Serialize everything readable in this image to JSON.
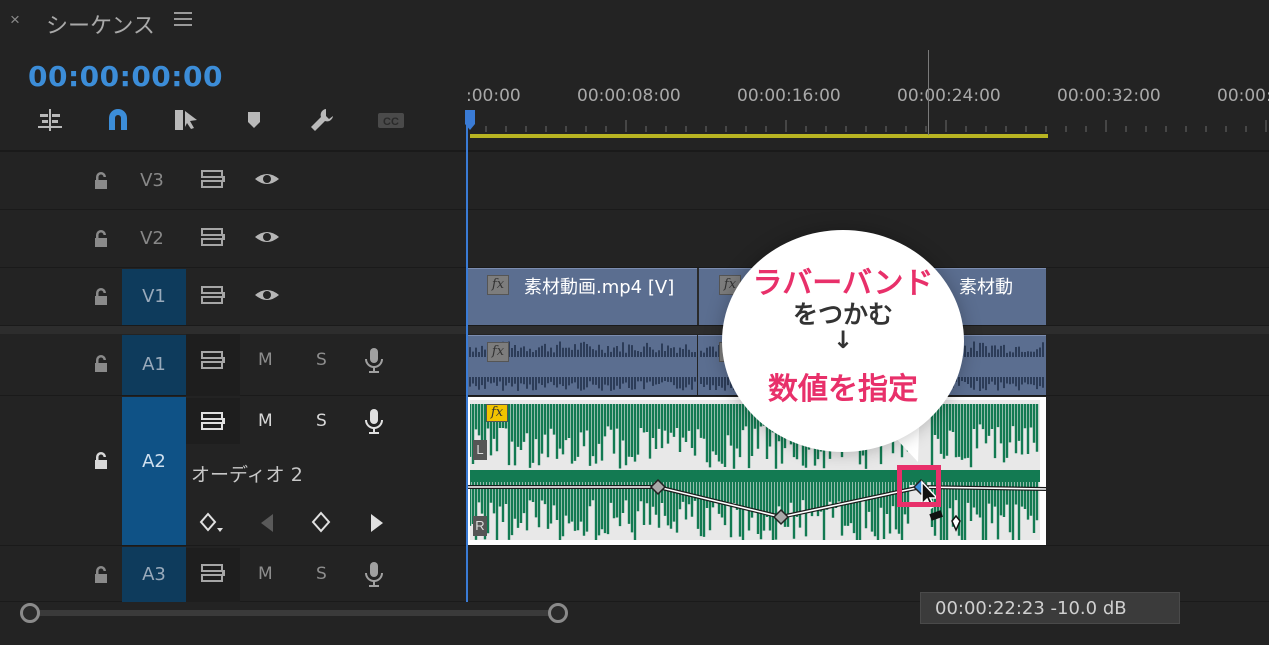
{
  "panel": {
    "close": "×",
    "title": "シーケンス"
  },
  "timecode": "00:00:00:00",
  "ruler": {
    "labels": [
      ":00:00",
      "00:00:08:00",
      "00:00:16:00",
      "00:00:24:00",
      "00:00:32:00",
      "00:00:"
    ]
  },
  "tracks": {
    "v3": {
      "label": "V3"
    },
    "v2": {
      "label": "V2"
    },
    "v1": {
      "label": "V1"
    },
    "a1": {
      "label": "A1",
      "mute": "M",
      "solo": "S"
    },
    "a2": {
      "label": "A2",
      "mute": "M",
      "solo": "S",
      "name": "オーディオ 2"
    },
    "a3": {
      "label": "A3",
      "mute": "M",
      "solo": "S"
    }
  },
  "clips": {
    "v1_clip1": "素材動画.mp4 [V]",
    "v1_clip3": "素材動",
    "fx": "fx"
  },
  "channels": {
    "left": "L",
    "right": "R"
  },
  "callout": {
    "line1": "ラバーバンド",
    "line2": "をつかむ",
    "arrow": "↓",
    "line3": "数値を指定"
  },
  "tooltip": "00:00:22:23  -10.0 dB",
  "colors": {
    "accent": "#3c8dd8",
    "highlight": "#e8306a",
    "clip_video": "#5b6e90",
    "wave_green": "#137a52",
    "work_bar": "#b8b422"
  }
}
